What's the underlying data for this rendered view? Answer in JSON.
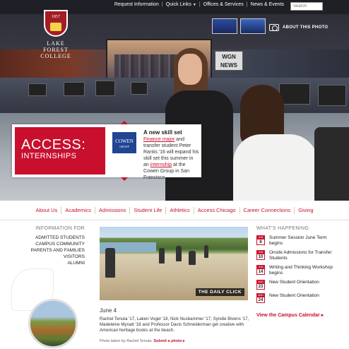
{
  "utility_nav": {
    "links": [
      {
        "label": "Request Information",
        "has_caret": false
      },
      {
        "label": "Quick Links",
        "has_caret": true
      },
      {
        "label": "Offices & Services",
        "has_caret": false
      },
      {
        "label": "News & Events",
        "has_caret": false
      }
    ],
    "search_placeholder": "Search"
  },
  "brand": {
    "year": "1857",
    "name_line1": "LAKE FOREST",
    "name_line2": "COLLEGE"
  },
  "hero": {
    "about_photo_label": "ABOUT THIS PHOTO",
    "screen_sign": "WGN NEWS",
    "feature": {
      "kicker": "ACCESS:",
      "title": "INTERNSHIPS",
      "logo_text": "COWEN",
      "logo_subtext": "GROUP",
      "headline": "A new skill set",
      "body": [
        {
          "text": "Finance major",
          "link": true
        },
        {
          "text": " and transfer student Peter Rantis '16 will expand his skill set this summer in an ",
          "link": false
        },
        {
          "text": "internship",
          "link": true
        },
        {
          "text": " at the Cowen Group in San Francisco.",
          "link": false
        }
      ]
    }
  },
  "main_nav": [
    "About Us",
    "Academics",
    "Admissions",
    "Student Life",
    "Athletics",
    "Access Chicago",
    "Career Connections",
    "Giving"
  ],
  "info_for": {
    "heading": "INFORMATION FOR",
    "items": [
      "ADMITTED STUDENTS",
      "CAMPUS COMMUNITY",
      "PARENTS AND FAMILIES",
      "VISITORS",
      "ALUMNI"
    ]
  },
  "daily_click": {
    "label": "THE DAILY CLICK",
    "date": "June 4",
    "caption": "Rachel Tenuta '17, Laken Vogel '18, Nick Nusbammer '17, Syndie Bivens '17, Madeleine Mynatt '18 and Professor Davis Schneiderman get creative with American heritage books at the beach.",
    "credit_prefix": "Photo taken by Rachel Tenuta.",
    "submit_label": "Submit a photo ▸"
  },
  "whats_happening": {
    "heading": "WHAT'S HAPPENING",
    "events": [
      {
        "month": "JUN",
        "day": "8",
        "title": "Summer Session June Term begins"
      },
      {
        "month": "JUN",
        "day": "10",
        "title": "Onsite Admissions for Transfer Students"
      },
      {
        "month": "JUN",
        "day": "14",
        "title": "Writing and Thinking Workshop begins"
      },
      {
        "month": "AUG",
        "day": "23",
        "title": "New Student Orientation"
      },
      {
        "month": "AUG",
        "day": "24",
        "title": "New Student Orientation"
      }
    ],
    "calendar_link": "View the Campus Calendar ▸"
  },
  "colors": {
    "brand_red": "#c8102e",
    "cowen_blue": "#214493"
  }
}
